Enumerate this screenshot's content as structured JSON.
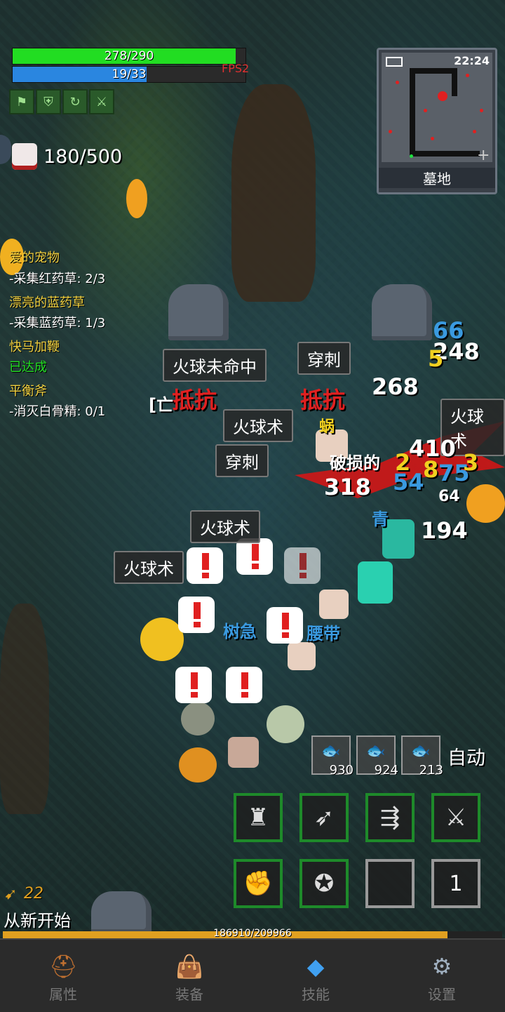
{
  "hud": {
    "hp": {
      "text": "278/290",
      "value": 278,
      "max": 290,
      "color": "#22dd22"
    },
    "mp": {
      "text": "19/33",
      "value": 19,
      "max": 33,
      "color": "#2a86e0"
    },
    "fps": "FPS2",
    "kill_counter": "180/500",
    "buffs": [
      "archer-buff-icon",
      "shield-buff-icon",
      "swirl-buff-icon",
      "sword-buff-icon"
    ]
  },
  "minimap": {
    "time": "22:24",
    "location": "墓地"
  },
  "quests": [
    {
      "title": "爱的宠物",
      "title_color": "#f0d040",
      "detail": "-采集红药草: 2/3"
    },
    {
      "title": "漂亮的蓝药草",
      "title_color": "#f0d040",
      "detail": "-采集蓝药草: 1/3"
    },
    {
      "title": "快马加鞭",
      "title_color": "#f0d040",
      "detail": "已达成",
      "detail_color": "#22dd22"
    },
    {
      "title": "平衡斧",
      "title_color": "#f0d040",
      "detail": "-消灭白骨精: 0/1"
    }
  ],
  "combat": {
    "skill_labels": [
      "火球未命中",
      "穿刺",
      "火球术",
      "穿刺",
      "火球术",
      "火球术",
      "火球术"
    ],
    "resist_labels": [
      "抵抗",
      "抵抗"
    ],
    "numbers": [
      "66",
      "248",
      "5",
      "268",
      "410",
      "2",
      "8",
      "75",
      "3",
      "318",
      "54",
      "64",
      "194"
    ],
    "fragments": [
      "破损的",
      "[亡",
      "青",
      "树急",
      "腰带",
      "蜗"
    ]
  },
  "items": [
    {
      "name": "red-fish-icon",
      "count": "930",
      "color": "#e04030"
    },
    {
      "name": "blue-fish-icon",
      "count": "924",
      "color": "#3a80e0"
    },
    {
      "name": "gray-fish-icon",
      "count": "213",
      "color": "#80c0e0"
    }
  ],
  "auto_label": "自动",
  "skills_row1": [
    "hooded-figure-icon",
    "wing-dash-icon",
    "triple-arrow-icon",
    "crossed-swords-icon"
  ],
  "skills_row2": [
    "fist-icon",
    "star-swirl-icon",
    "",
    ""
  ],
  "potion_slot": "1",
  "gold": "22",
  "restart_label": "从新开始",
  "xp": {
    "text": "186910/209966",
    "value": 186910,
    "max": 209966,
    "color": "#e0a020"
  },
  "nav": [
    {
      "label": "属性",
      "icon": "helmet-icon"
    },
    {
      "label": "装备",
      "icon": "bag-icon"
    },
    {
      "label": "技能",
      "icon": "gem-icon"
    },
    {
      "label": "设置",
      "icon": "gear-icon"
    }
  ]
}
